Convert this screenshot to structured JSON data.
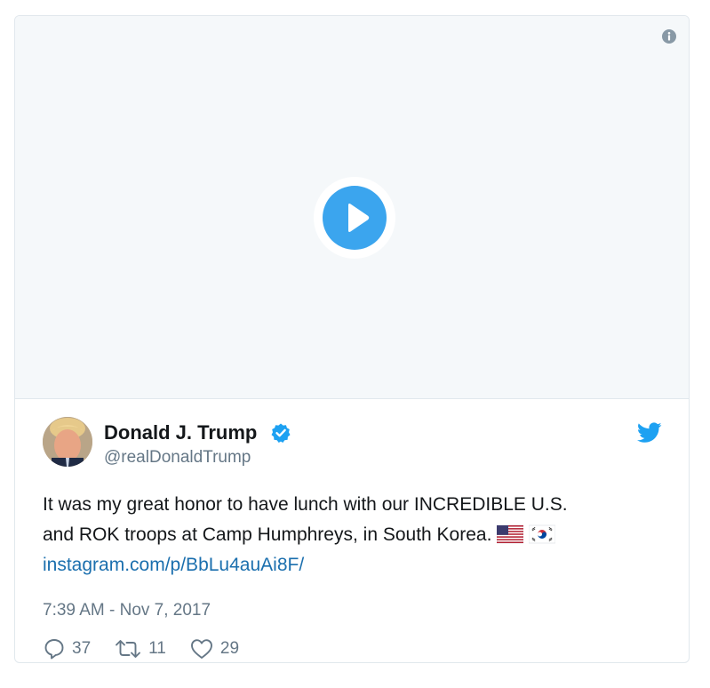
{
  "media": {
    "info_icon": "info-icon",
    "play_icon": "play-icon",
    "play_color": "#3ba5ee"
  },
  "author": {
    "name": "Donald J. Trump",
    "handle": "@realDonaldTrump",
    "verified": true,
    "verified_color": "#1da1f2"
  },
  "tweet": {
    "text_line_1": "It was my great honor to have lunch with our INCREDIBLE U.S.",
    "text_line_2": "and ROK troops at Camp Humphreys, in South Korea.",
    "flags": [
      "us-flag-icon",
      "south-korea-flag-icon"
    ],
    "link": "instagram.com/p/BbLu4auAi8F/",
    "timestamp": "7:39 AM - Nov 7, 2017"
  },
  "actions": {
    "replies": "37",
    "retweets": "11",
    "likes": "29"
  },
  "colors": {
    "brand_blue": "#1da1f2",
    "link": "#1b6fae",
    "text": "#14171a",
    "secondary": "#657786"
  }
}
